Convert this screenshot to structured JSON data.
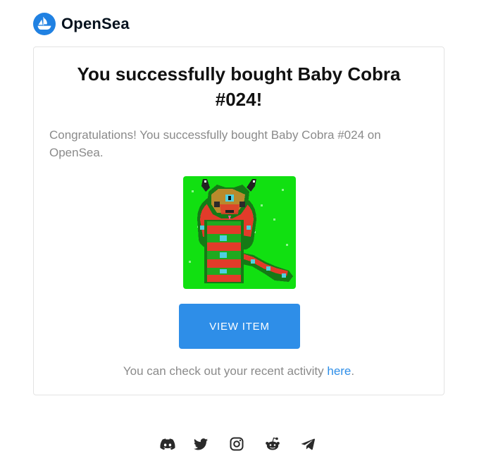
{
  "brand": {
    "name": "OpenSea",
    "logo_icon": "opensea-logo-icon",
    "accent_color": "#2081e2"
  },
  "email": {
    "title": "You successfully bought Baby Cobra #024!",
    "message": "Congratulations! You successfully bought Baby Cobra #024 on OpenSea.",
    "item_image": {
      "icon": "baby-cobra-nft-image",
      "background_color": "#11e011"
    },
    "button_label": "VIEW ITEM",
    "activity_prefix": "You can check out your recent activity ",
    "activity_link": "here",
    "activity_suffix": ".",
    "button_color": "#2e8ee8"
  },
  "footer": {
    "social_icons": [
      "discord-icon",
      "twitter-icon",
      "instagram-icon",
      "reddit-icon",
      "telegram-icon"
    ],
    "icon_color": "#2a2a2a"
  }
}
